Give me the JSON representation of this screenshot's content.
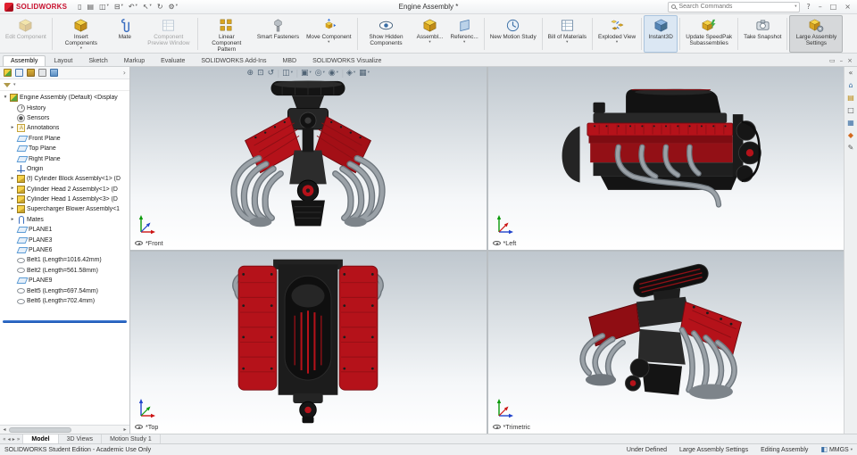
{
  "titlebar": {
    "logo_text": "SOLIDWORKS",
    "document_title": "Engine Assembly *",
    "search": {
      "placeholder": "Search Commands"
    }
  },
  "ribbon": {
    "buttons": [
      {
        "label": "Edit Component"
      },
      {
        "label": "Insert Components"
      },
      {
        "label": "Mate"
      },
      {
        "label": "Component Preview Window"
      },
      {
        "label": "Linear Component Pattern"
      },
      {
        "label": "Smart Fasteners"
      },
      {
        "label": "Move Component"
      },
      {
        "label": "Show Hidden Components"
      },
      {
        "label": "Assembl..."
      },
      {
        "label": "Referenc..."
      },
      {
        "label": "New Motion Study"
      },
      {
        "label": "Bill of Materials"
      },
      {
        "label": "Exploded View"
      },
      {
        "label": "Instant3D"
      },
      {
        "label": "Update SpeedPak Subassemblies"
      },
      {
        "label": "Take Snapshot"
      },
      {
        "label": "Large Assembly Settings"
      }
    ]
  },
  "command_tabs": [
    "Assembly",
    "Layout",
    "Sketch",
    "Markup",
    "Evaluate",
    "SOLIDWORKS Add-Ins",
    "MBD",
    "SOLIDWORKS Visualize"
  ],
  "feature_tree": {
    "items": [
      {
        "label": "Engine Assembly (Default) <Display"
      },
      {
        "label": "History"
      },
      {
        "label": "Sensors"
      },
      {
        "label": "Annotations"
      },
      {
        "label": "Front Plane"
      },
      {
        "label": "Top Plane"
      },
      {
        "label": "Right Plane"
      },
      {
        "label": "Origin"
      },
      {
        "label": "(f) Cylinder Block Assembly<1> (D"
      },
      {
        "label": "Cylinder Head 2 Assembly<1> (D"
      },
      {
        "label": "Cylinder Head 1 Assembly<3> (D"
      },
      {
        "label": "Supercharger Blower Assembly<1"
      },
      {
        "label": "Mates"
      },
      {
        "label": "PLANE1"
      },
      {
        "label": "PLANE3"
      },
      {
        "label": "PLANE6"
      },
      {
        "label": "Belt1 (Length=1016.42mm)"
      },
      {
        "label": "Belt2 (Length=561.58mm)"
      },
      {
        "label": "PLANE9"
      },
      {
        "label": "Belt5 (Length=697.54mm)"
      },
      {
        "label": "Belt6 (Length=702.4mm)"
      }
    ]
  },
  "viewports": {
    "front": {
      "label": "*Front"
    },
    "left": {
      "label": "*Left"
    },
    "top": {
      "label": "*Top"
    },
    "trimetric": {
      "label": "*Trimetric"
    }
  },
  "document_tabs": [
    "Model",
    "3D Views",
    "Motion Study 1"
  ],
  "status_bar": {
    "edition": "SOLIDWORKS Student Edition - Academic Use Only",
    "constraint_status": "Under Defined",
    "mode": "Large Assembly Settings",
    "editing": "Editing Assembly",
    "units": "MMGS"
  },
  "icons": {
    "caret": "▾",
    "chevron_right": "›",
    "qat": {
      "new": "▯",
      "open": "▤",
      "save": "◫",
      "print": "⊟",
      "undo": "↶",
      "select": "↖",
      "rebuild": "↻",
      "options": "⚙"
    },
    "window": {
      "help": "?",
      "minimize": "–",
      "maximize": "□",
      "close": "×",
      "doc_restore": "▭"
    },
    "hud": {
      "zoom_fit": "⊕",
      "zoom_area": "⊡",
      "previous_view": "↺",
      "section_view": "◫",
      "view_orientation": "▣",
      "display_style": "◎",
      "hide_show": "◉",
      "edit_appearance": "◈",
      "view_settings": "▦"
    },
    "taskpane": {
      "collapse": "«",
      "resources": "⌂",
      "design_library": "▤",
      "file_explorer": "□",
      "view_palette": "▦",
      "appearances": "◆",
      "custom_props": "✎"
    },
    "nav": {
      "first": "«",
      "prev": "◂",
      "next": "▸",
      "last": "»"
    },
    "status_badge": "◧"
  },
  "colors": {
    "accent_red": "#b5121a",
    "pipe_gray": "#9aa0a5",
    "selection_blue": "#2a6bd4"
  }
}
